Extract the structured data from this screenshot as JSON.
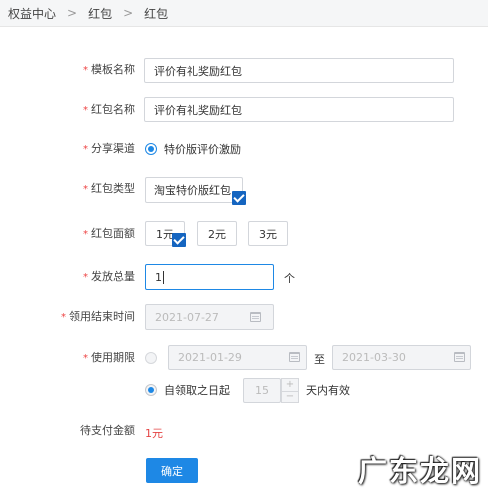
{
  "breadcrumb": [
    "权益中心",
    "红包",
    "红包"
  ],
  "breadcrumb_sep": ">",
  "form": {
    "template_name": {
      "label": "模板名称",
      "value": "评价有礼奖励红包"
    },
    "redpacket_name": {
      "label": "红包名称",
      "value": "评价有礼奖励红包"
    },
    "share_channel": {
      "label": "分享渠道",
      "option": "特价版评价激励"
    },
    "redpacket_type": {
      "label": "红包类型",
      "option": "淘宝特价版红包"
    },
    "amount": {
      "label": "红包面额",
      "options": [
        "1元",
        "2元",
        "3元"
      ],
      "selected": "1元"
    },
    "total": {
      "label": "发放总量",
      "value": "1",
      "unit": "个"
    },
    "claim_end": {
      "label": "领用结束时间",
      "value": "2021-07-27"
    },
    "usage": {
      "label": "使用期限",
      "start": "2021-01-29",
      "to": "至",
      "end": "2021-03-30",
      "relative_prefix": "自领取之日起",
      "days": "15",
      "relative_suffix": "天内有效"
    },
    "pay": {
      "label": "待支付金额",
      "value": "1元"
    },
    "submit": "确定"
  },
  "required_mark": "*",
  "watermark": "广东龙网",
  "colors": {
    "primary": "#1e88e5",
    "danger": "#e44444"
  }
}
